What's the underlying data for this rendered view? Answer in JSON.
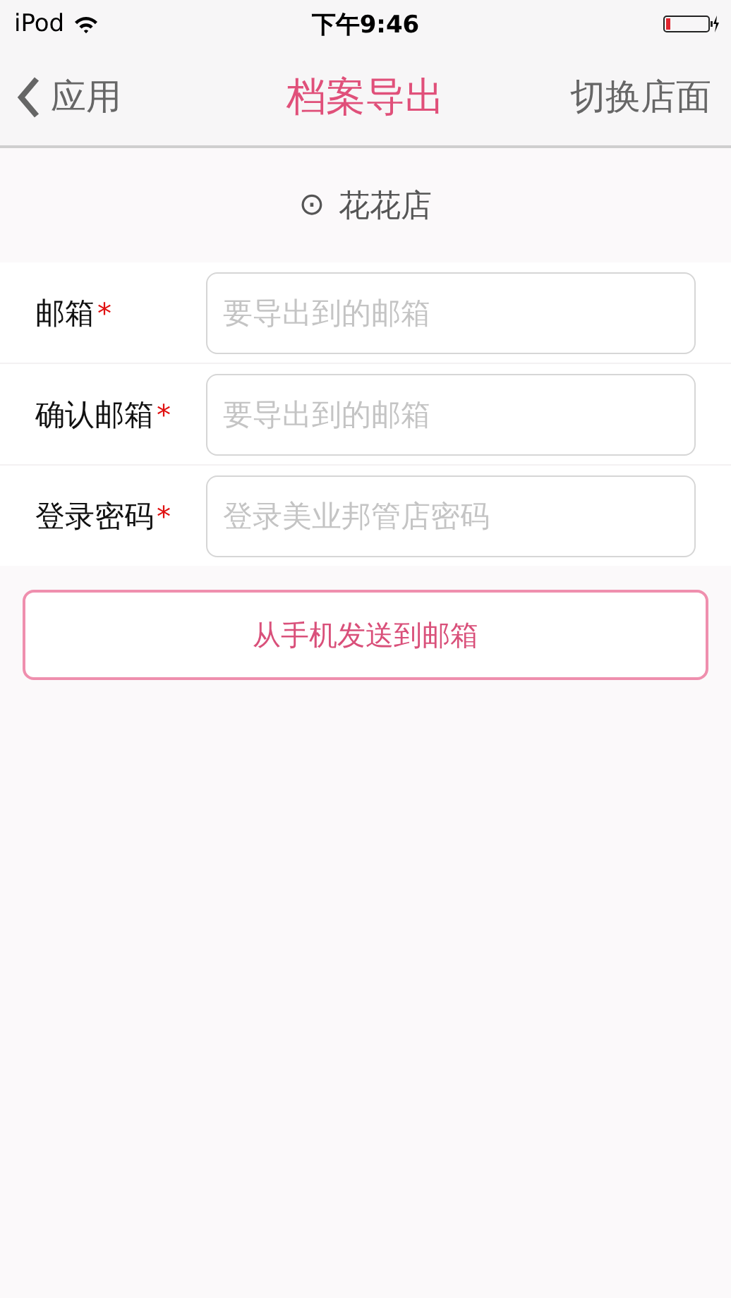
{
  "status_bar": {
    "carrier": "iPod",
    "time": "下午9:46"
  },
  "nav": {
    "back": "应用",
    "title": "档案导出",
    "action": "切换店面"
  },
  "store": {
    "symbol": "⊙",
    "name": "花花店"
  },
  "fields": [
    {
      "label": "邮箱",
      "mark": "*",
      "placeholder": "要导出到的邮箱"
    },
    {
      "label": "确认邮箱",
      "mark": "*",
      "placeholder": "要导出到的邮箱"
    },
    {
      "label": "登录密码",
      "mark": "*",
      "placeholder": "登录美业邦管店密码"
    }
  ],
  "submit": "从手机发送到邮箱"
}
